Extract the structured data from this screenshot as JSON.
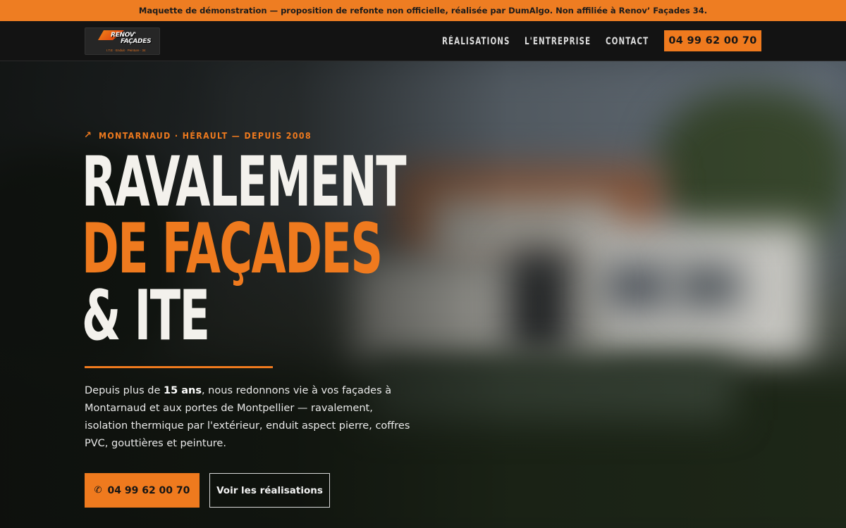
{
  "banner": {
    "text": "Maquette de démonstration — proposition de refonte non officielle, réalisée par DumAlgo. Non affiliée à Renov’ Façades 34."
  },
  "logo": {
    "line1": "RENOV'",
    "line2": "FAÇADES",
    "tagline": "I.T.E · Enduit · Peinture · 34"
  },
  "nav": {
    "items": [
      {
        "label": "RÉALISATIONS"
      },
      {
        "label": "L'ENTREPRISE"
      },
      {
        "label": "CONTACT"
      }
    ],
    "phone": "04 99 62 00 70"
  },
  "hero": {
    "eyebrow_icon": "arrow-up-right-icon",
    "eyebrow": "MONTARNAUD · HÉRAULT — DEPUIS 2008",
    "headline_line1": "RAVALEMENT",
    "headline_line2": "DE FAÇADES",
    "headline_line3": "& ITE",
    "lead_before": "Depuis plus de ",
    "lead_bold": "15 ans",
    "lead_after": ", nous redonnons vie à vos façades à Montarnaud et aux portes de Montpellier — ravalement, isolation thermique par l'extérieur, enduit aspect pierre, coffres PVC, gouttières et peinture.",
    "cta_primary": "04 99 62 00 70",
    "cta_primary_icon": "phone-icon",
    "cta_secondary": "Voir les réalisations"
  },
  "colors": {
    "accent": "#ef7a1e",
    "nav_bg": "#131313",
    "text_light": "#f3f1ec"
  }
}
